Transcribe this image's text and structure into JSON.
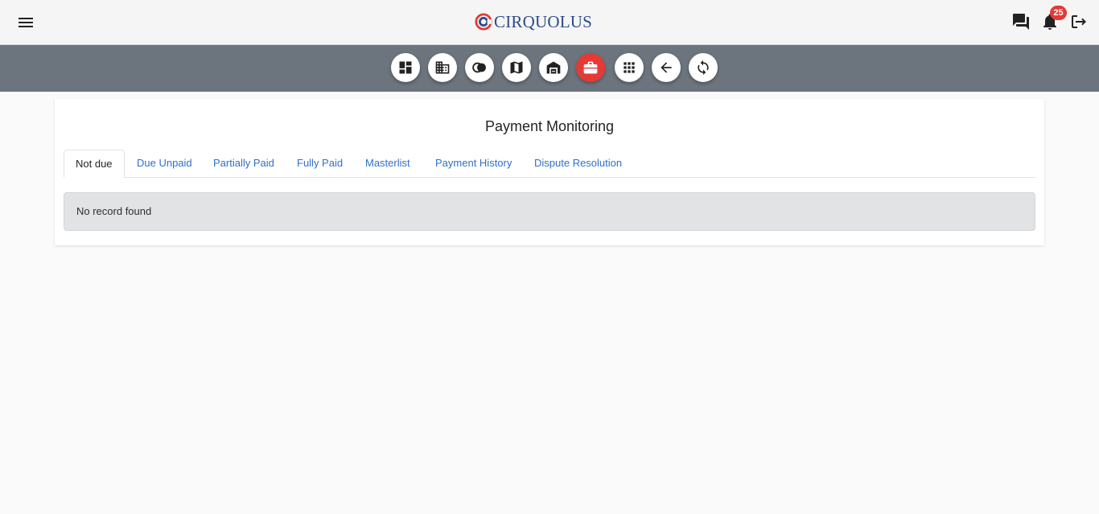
{
  "header": {
    "logo_text": "CIRQUOLUS",
    "notification_count": "25",
    "icons": [
      "menu-icon",
      "chat-icon",
      "bell-icon",
      "logout-icon"
    ]
  },
  "toolbar": {
    "buttons": [
      "dashboard-icon",
      "building-icon",
      "circles-icon",
      "map-icon",
      "garage-icon",
      "briefcase-icon",
      "apps-grid-icon",
      "arrow-back-icon",
      "refresh-icon"
    ],
    "active_index": 5,
    "active_color": "#e53935",
    "bar_color": "#6c757d"
  },
  "main": {
    "title": "Payment Monitoring",
    "tabs": [
      {
        "label": "Not due",
        "active": true
      },
      {
        "label": "Due Unpaid"
      },
      {
        "label": "Partially Paid"
      },
      {
        "label": "Fully Paid"
      },
      {
        "label": "Masterlist"
      },
      {
        "label": "Payment History"
      },
      {
        "label": "Dispute Resolution"
      }
    ],
    "empty_message": "No record found"
  }
}
